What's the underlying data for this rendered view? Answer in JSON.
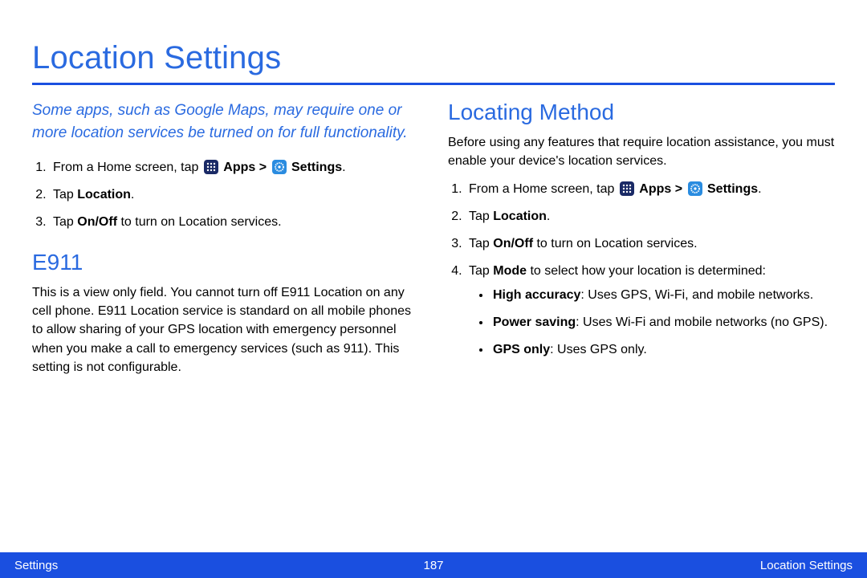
{
  "title": "Location Settings",
  "intro": "Some apps, such as Google Maps, may require one or more location services be turned on for full functionality.",
  "left": {
    "steps": {
      "s1": {
        "prefix": "From a Home screen, tap ",
        "apps_label": "Apps",
        "sep": " > ",
        "settings_label": "Settings",
        "suffix": "."
      },
      "s2": {
        "prefix": "Tap ",
        "bold": "Location",
        "suffix": "."
      },
      "s3": {
        "prefix": "Tap ",
        "bold": "On/Off",
        "suffix": " to turn on Location services."
      }
    },
    "e911": {
      "heading": "E911",
      "body": "This is a view only field. You cannot turn off E911 Location on any cell phone. E911 Location service is standard on all mobile phones to allow sharing of your GPS location with emergency personnel when you make a call to emergency services (such as 911). This setting is not configurable."
    }
  },
  "right": {
    "heading": "Locating Method",
    "intro_body": "Before using any features that require location assistance, you must enable your device's location services.",
    "steps": {
      "s1": {
        "prefix": "From a Home screen, tap ",
        "apps_label": "Apps",
        "sep": " > ",
        "settings_label": "Settings",
        "suffix": "."
      },
      "s2": {
        "prefix": "Tap ",
        "bold": "Location",
        "suffix": "."
      },
      "s3": {
        "prefix": "Tap ",
        "bold": "On/Off",
        "suffix": " to turn on Location services."
      },
      "s4": {
        "prefix": "Tap ",
        "bold": "Mode",
        "suffix": " to select how your location is determined:"
      }
    },
    "modes": {
      "m1": {
        "bold": "High accuracy",
        "rest": ": Uses GPS, Wi-Fi, and mobile networks."
      },
      "m2": {
        "bold": "Power saving",
        "rest": ": Uses Wi-Fi and mobile networks (no GPS)."
      },
      "m3": {
        "bold": "GPS only",
        "rest": ": Uses GPS only."
      }
    }
  },
  "footer": {
    "left": "Settings",
    "page": "187",
    "right": "Location Settings"
  }
}
